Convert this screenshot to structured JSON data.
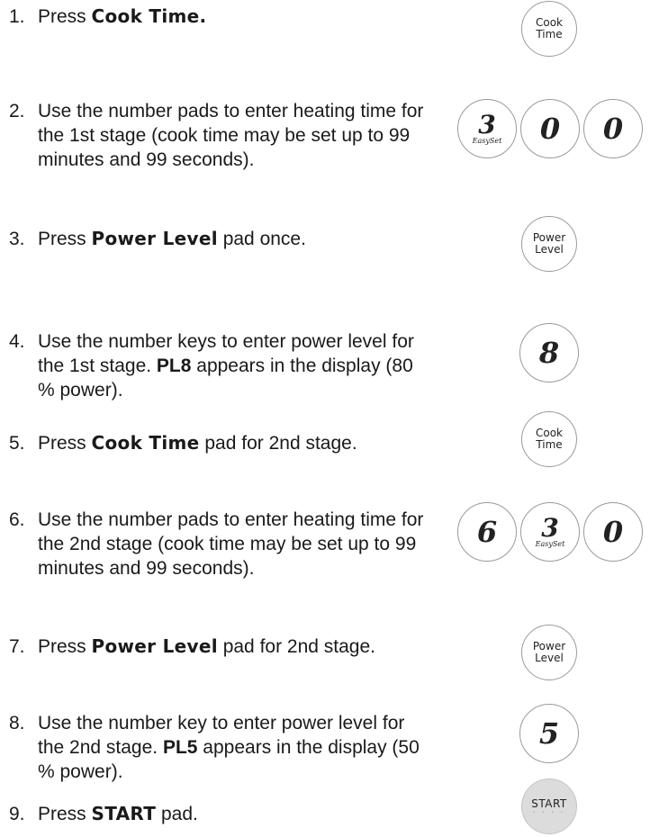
{
  "steps": [
    {
      "num": "1.",
      "pre": "Press ",
      "kw": "Cook Time.",
      "post": ""
    },
    {
      "num": "2.",
      "text": "Use the number pads to enter heating time for the 1st stage (cook time may be set up to 99 minutes and 99 seconds)."
    },
    {
      "num": "3.",
      "pre": "Press ",
      "kw": "Power Level",
      "post": " pad once."
    },
    {
      "num": "4.",
      "pre": "Use the number keys to enter power level for the 1st stage. ",
      "bold": "PL8",
      "post": " appears in the display (80 % power)."
    },
    {
      "num": "5.",
      "pre": "Press ",
      "kw": "Cook Time",
      "post": " pad for 2nd stage."
    },
    {
      "num": "6.",
      "text": "Use the number pads to enter heating time for the 2nd stage (cook time may be set up to 99 minutes and 99 seconds)."
    },
    {
      "num": "7.",
      "pre": "Press ",
      "kw": "Power Level",
      "post": " pad for 2nd stage."
    },
    {
      "num": "8.",
      "pre": "Use the number key to enter power level for the 2nd stage. ",
      "bold": "PL5",
      "post": " appears in the display (50 % power)."
    },
    {
      "num": "9.",
      "pre": "Press ",
      "kw": "START",
      "post": " pad."
    }
  ],
  "pads": {
    "cook_time_line1": "Cook",
    "cook_time_line2": "Time",
    "power_level_line1": "Power",
    "power_level_line2": "Level",
    "easyset": "EasySet",
    "digit_3": "3",
    "digit_0": "0",
    "digit_8": "8",
    "digit_6": "6",
    "digit_5": "5",
    "start": "START",
    "start_dots": "· · · ·"
  }
}
